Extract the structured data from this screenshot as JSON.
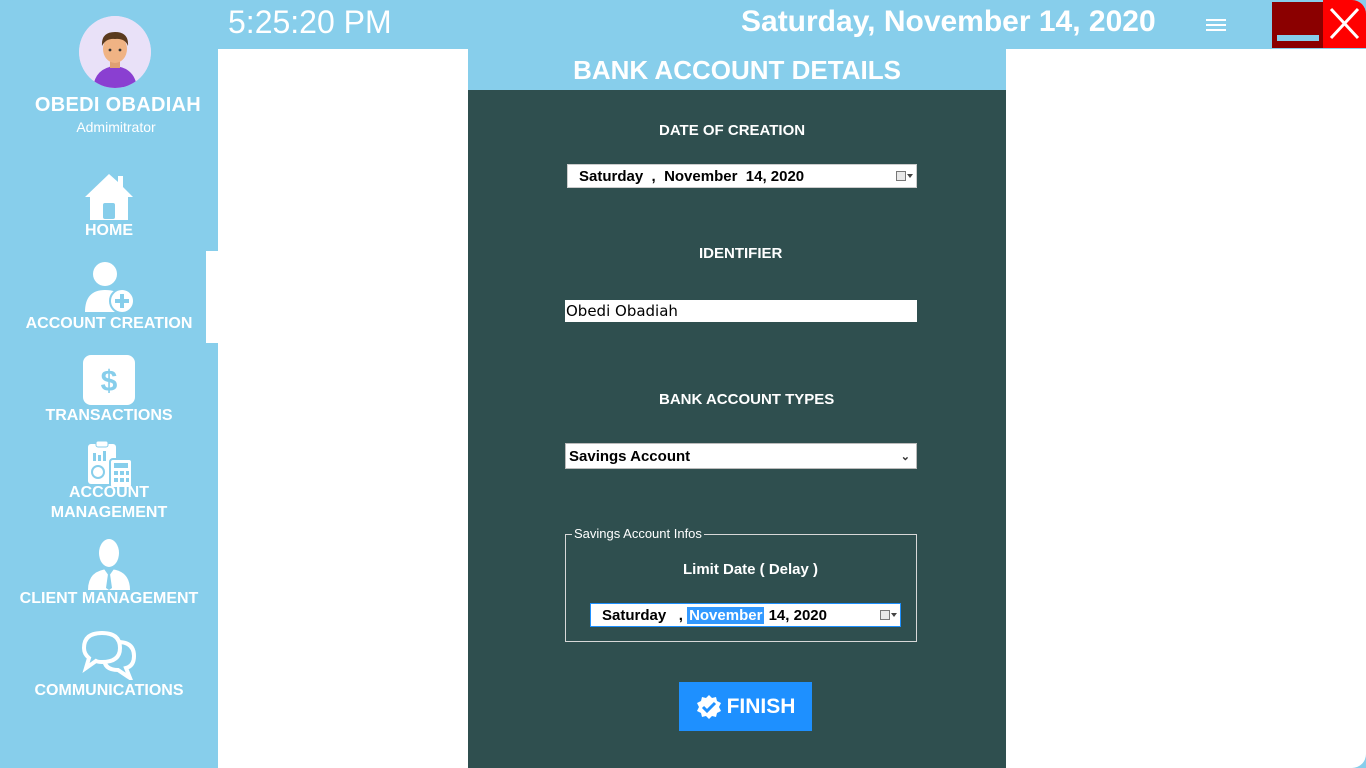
{
  "topbar": {
    "time": "5:25:20 PM",
    "date": "Saturday, November 14, 2020"
  },
  "user": {
    "name": "OBEDI OBADIAH",
    "role": "Admimitrator"
  },
  "nav": {
    "items": [
      {
        "label": "HOME",
        "icon": "home-icon"
      },
      {
        "label": "ACCOUNT CREATION",
        "icon": "add-user-icon"
      },
      {
        "label": "TRANSACTIONS",
        "icon": "dollar-icon"
      },
      {
        "label": "ACCOUNT",
        "label2": "MANAGEMENT",
        "icon": "calculator-icon"
      },
      {
        "label": "CLIENT MANAGEMENT",
        "icon": "business-person-icon"
      },
      {
        "label": "COMMUNICATIONS",
        "icon": "chat-bubbles-icon"
      }
    ],
    "active": "ACCOUNT CREATION"
  },
  "panel": {
    "title": "BANK ACCOUNT DETAILS",
    "creation_date_label": "DATE OF CREATION",
    "creation_date": {
      "day": "Saturday",
      "sep": ",",
      "month": "November",
      "rest": "14, 2020"
    },
    "identifier_label": "IDENTIFIER",
    "identifier_value": "Obedi Obadiah",
    "account_types_label": "BANK ACCOUNT TYPES",
    "account_type_selected": "Savings Account",
    "group": {
      "legend": "Savings Account Infos",
      "limit_label": "Limit Date ( Delay )",
      "limit_date": {
        "day": "Saturday",
        "sep": ",",
        "month": "November",
        "rest": "14, 2020"
      }
    },
    "finish_label": "FINISH"
  },
  "colors": {
    "sidebar": "#87ceeb",
    "panel": "#2f4f4f",
    "accent": "#1e90ff",
    "close": "#ff0000",
    "minimize": "#8b0000"
  }
}
